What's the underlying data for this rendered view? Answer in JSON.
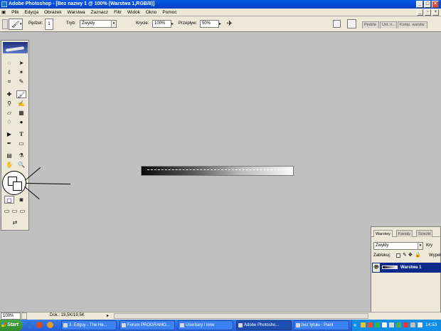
{
  "window": {
    "title": "Adobe Photoshop - [Bez nazwy 1 @ 100% (Warstwa 1,RGB/8)]",
    "controls": {
      "minimize": "_",
      "maximize": "□",
      "close": "×"
    }
  },
  "menu": {
    "items": [
      "Plik",
      "Edycja",
      "Obrazek",
      "Warstwa",
      "Zaznacz",
      "Filtr",
      "Widok",
      "Okno",
      "Pomoc"
    ]
  },
  "options": {
    "brush_label": "Pędzel:",
    "brush_size": "1",
    "mode_label": "Tryb:",
    "mode_value": "Zwykły",
    "opacity_label": "Krycie:",
    "opacity_value": "100%",
    "flow_label": "Przepływ:",
    "flow_value": "50%",
    "palette_tabs": [
      "Pędzle",
      "Ust. n...",
      "Komp. warstw"
    ]
  },
  "layers_palette": {
    "tabs": [
      "Warstwy",
      "Kanały",
      "Ścieżki"
    ],
    "blend_mode": "Zwykły",
    "opacity_label": "Kry",
    "lock_label": "Zablokuj:",
    "fill_label": "Wypeł",
    "layer_name": "Warstwa 1",
    "eye_icon": "eye-icon"
  },
  "status": {
    "zoom": "100%",
    "doc_info": "Dok.: 19,5K/19,5K"
  },
  "taskbar": {
    "start_label": "Start",
    "tasks": [
      {
        "label": "3. Edguy - The He...",
        "active": false
      },
      {
        "label": "Forum PROGRAMO...",
        "active": false
      },
      {
        "label": "Userbary i inne",
        "active": false
      },
      {
        "label": "Adobe Photosho...",
        "active": true
      },
      {
        "label": "bez tytułu - Paint",
        "active": false
      }
    ],
    "tray_arrow": "«",
    "clock": "14:53"
  },
  "colors": {
    "title_bar": "#0041c8",
    "chrome": "#ece9d8",
    "workspace": "#c0c0c0",
    "selected_layer": "#0b2a8a",
    "taskbar": "#245edb",
    "start_button": "#2f8a2b"
  }
}
